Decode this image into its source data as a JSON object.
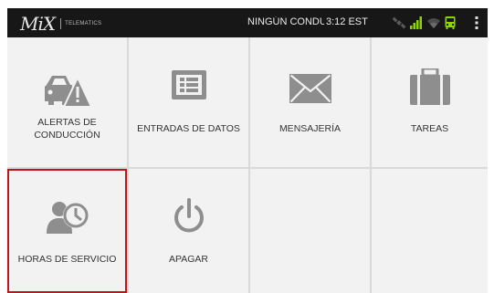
{
  "statusbar": {
    "logo_text": "MiX",
    "logo_subtext": "TELEMATICS",
    "driver_status": "NINGÚN CONDUCTOR",
    "time": "3:12 EST",
    "icons": [
      "satellite-icon",
      "signal-icon",
      "wifi-icon",
      "bus-icon",
      "overflow-menu-icon"
    ],
    "colors": {
      "signal": "#8fd400",
      "bus": "#8fd400",
      "bar_bg": "#171717"
    }
  },
  "menu": {
    "tiles": [
      {
        "label": "ALERTAS DE CONDUCCIÓN",
        "icon": "driving-alert-icon"
      },
      {
        "label": "ENTRADAS DE DATOS",
        "icon": "data-entry-icon"
      },
      {
        "label": "MENSAJERÍA",
        "icon": "envelope-icon"
      },
      {
        "label": "TAREAS",
        "icon": "briefcase-icon"
      },
      {
        "label": "HORAS DE SERVICIO",
        "icon": "hours-of-service-icon",
        "selected": true
      },
      {
        "label": "APAGAR",
        "icon": "power-icon"
      }
    ],
    "colors": {
      "tile": "#f2f2f2",
      "icon": "#8e8e8e",
      "selected_border": "#c0141c"
    }
  }
}
